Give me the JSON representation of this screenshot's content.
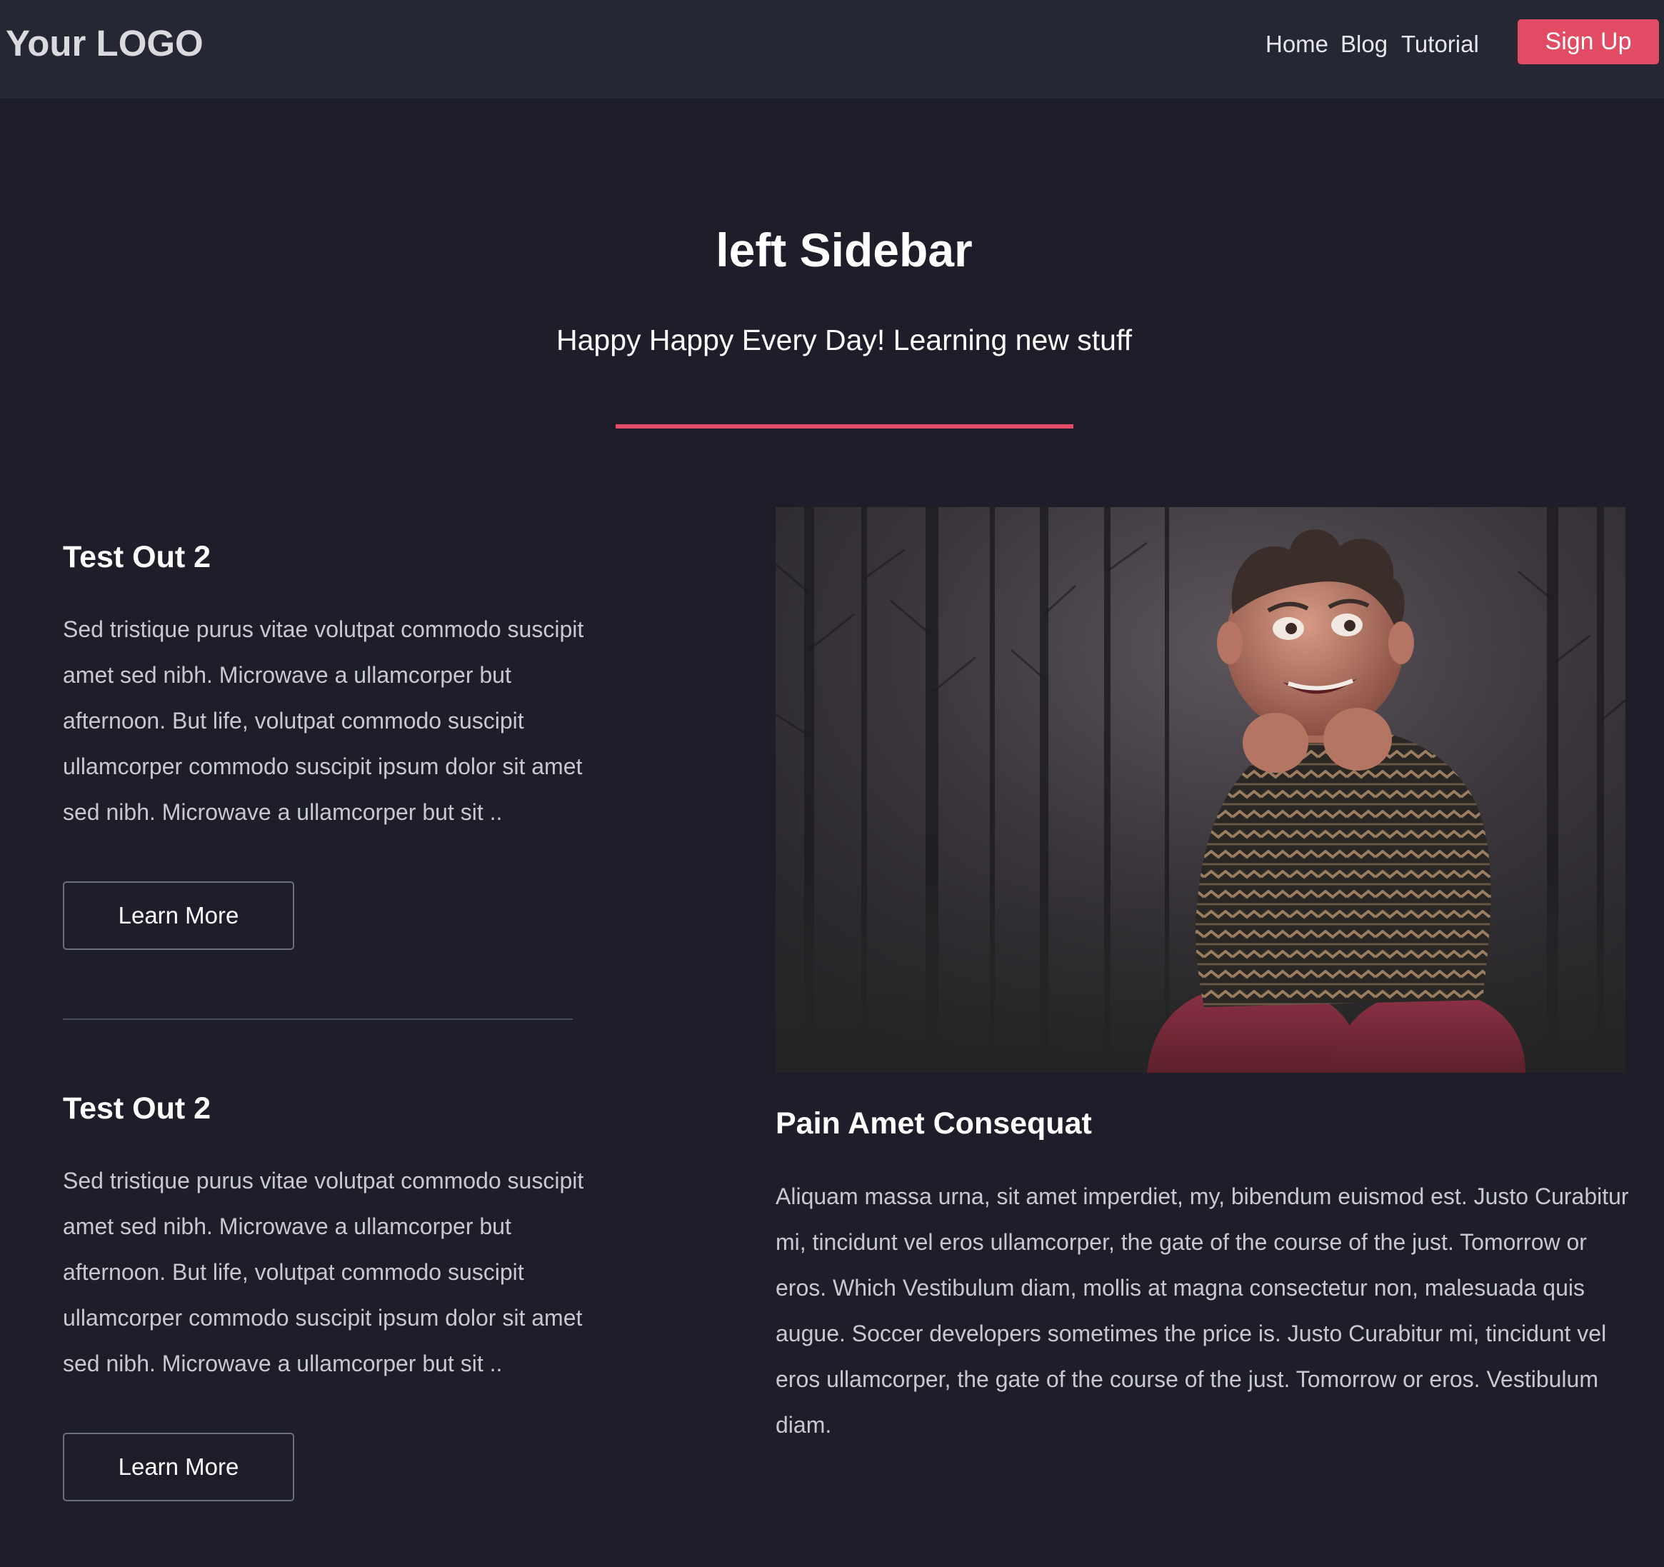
{
  "header": {
    "logo": "Your LOGO",
    "nav": {
      "home": "Home",
      "blog": "Blog",
      "tutorial": "Tutorial"
    },
    "signup_label": "Sign Up"
  },
  "hero": {
    "title": "left Sidebar",
    "subtitle": "Happy Happy Every Day! Learning new stuff"
  },
  "sidebar": {
    "cards": [
      {
        "title": "Test Out 2",
        "text": "Sed tristique purus vitae volutpat commodo suscipit amet sed nibh. Microwave a ullamcorper but afternoon. But life, volutpat commodo suscipit ullamcorper commodo suscipit ipsum dolor sit amet sed nibh. Microwave a ullamcorper but sit ..",
        "button": "Learn More"
      },
      {
        "title": "Test Out 2",
        "text": "Sed tristique purus vitae volutpat commodo suscipit amet sed nibh. Microwave a ullamcorper but afternoon. But life, volutpat commodo suscipit ullamcorper commodo suscipit ipsum dolor sit amet sed nibh. Microwave a ullamcorper but sit ..",
        "button": "Learn More"
      }
    ]
  },
  "main": {
    "title": "Pain Amet Consequat",
    "text": "Aliquam massa urna, sit amet imperdiet, my, bibendum euismod est. Justo Curabitur mi, tincidunt vel eros ullamcorper, the gate of the course of the just. Tomorrow or eros. Which Vestibulum diam, mollis at magna consectetur non, malesuada quis augue. Soccer developers sometimes the price is. Justo Curabitur mi, tincidunt vel eros ullamcorper, the gate of the course of the just. Tomorrow or eros. Vestibulum diam."
  },
  "colors": {
    "background": "#1d1e2a",
    "navbar": "#252734",
    "accent": "#e14b63",
    "body_text": "#c7c8d0"
  }
}
